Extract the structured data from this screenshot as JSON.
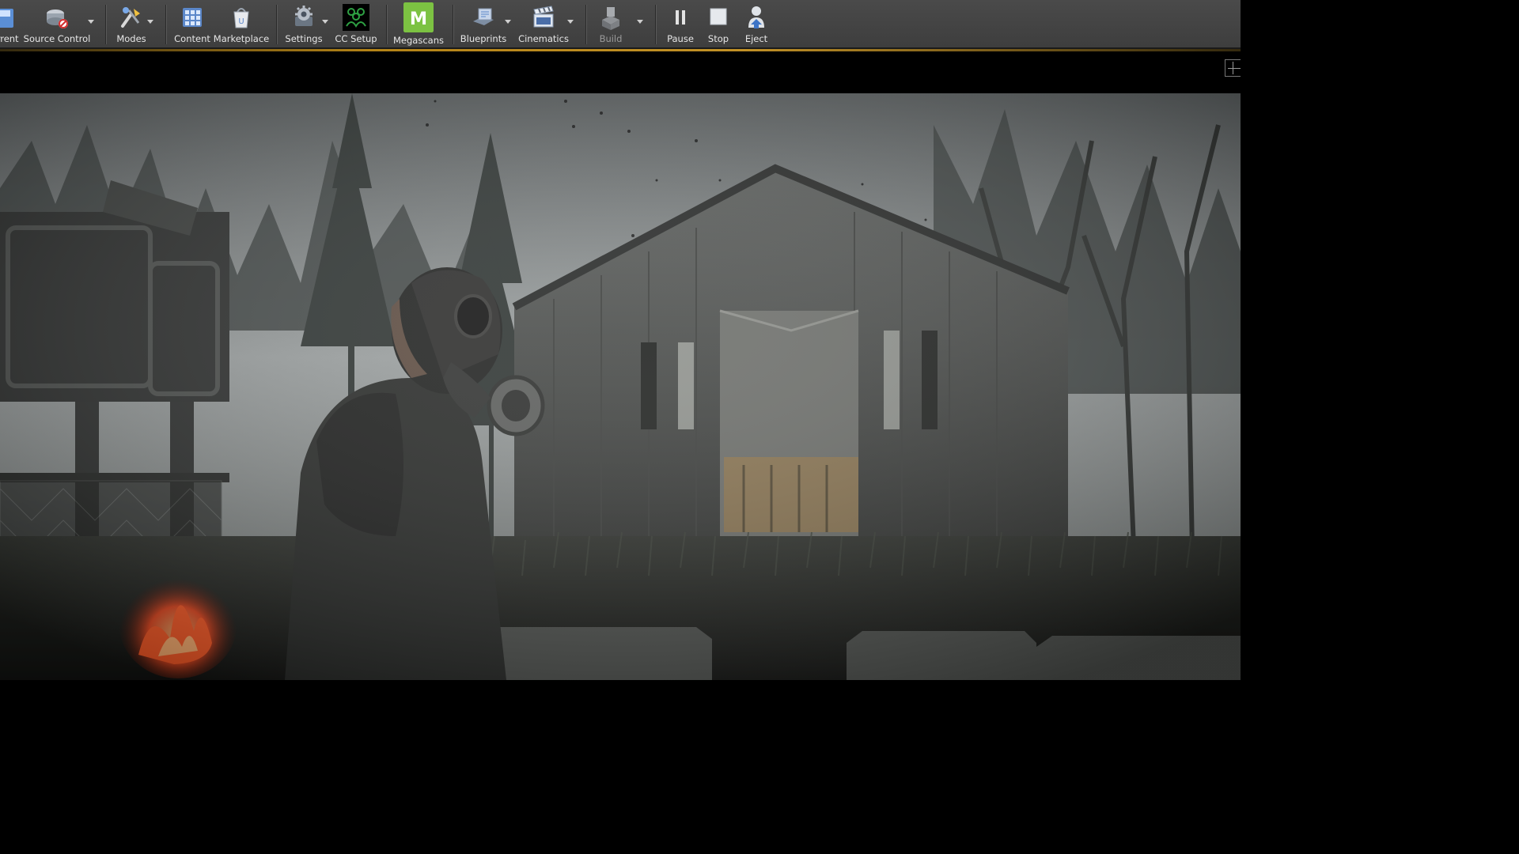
{
  "toolbar": {
    "items": [
      {
        "label": "urrent",
        "icon": "save-current-icon"
      },
      {
        "label": "Source Control",
        "icon": "source-control-icon"
      },
      {
        "label": "Modes",
        "icon": "modes-icon"
      },
      {
        "label": "Content",
        "icon": "content-browser-icon"
      },
      {
        "label": "Marketplace",
        "icon": "marketplace-icon"
      },
      {
        "label": "Settings",
        "icon": "settings-gear-icon"
      },
      {
        "label": "CC Setup",
        "icon": "cc-setup-icon"
      },
      {
        "label": "Megascans",
        "icon": "megascans-logo-icon"
      },
      {
        "label": "Blueprints",
        "icon": "blueprints-icon"
      },
      {
        "label": "Cinematics",
        "icon": "clapperboard-icon"
      },
      {
        "label": "Build",
        "icon": "build-icon",
        "disabled": true
      },
      {
        "label": "Pause",
        "icon": "pause-icon"
      },
      {
        "label": "Stop",
        "icon": "stop-icon"
      },
      {
        "label": "Eject",
        "icon": "eject-icon"
      }
    ],
    "megascans_letter": "M",
    "accent_color": "#d7a12b",
    "megascans_color": "#7cc242",
    "cc_color": "#2ea043"
  },
  "viewport": {
    "scene_description_icon": "viewport-scene",
    "options_icon": "viewport-layout-icon"
  }
}
